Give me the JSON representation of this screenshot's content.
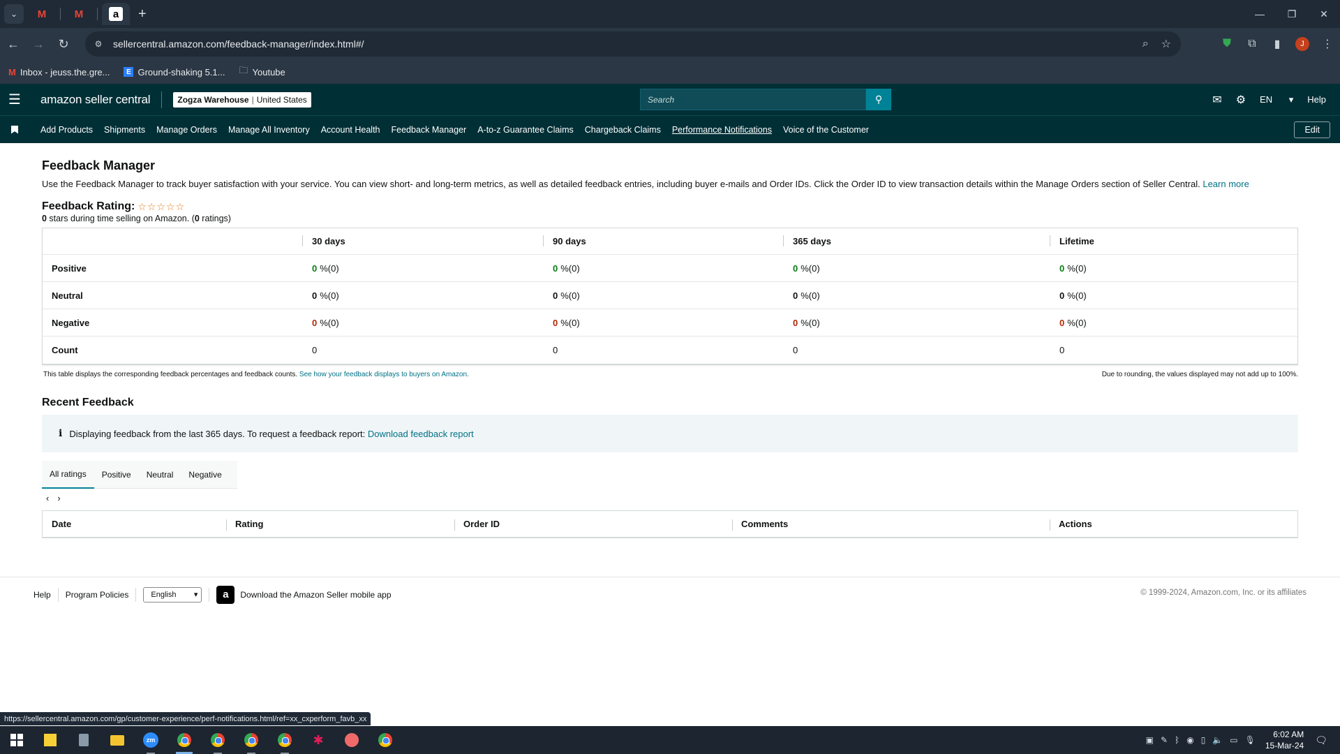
{
  "browser": {
    "url": "sellercentral.amazon.com/feedback-manager/index.html#/",
    "bookmarks": [
      "Inbox - jeuss.the.gre...",
      "Ground-shaking 5.1...",
      "Youtube"
    ],
    "status_url": "https://sellercentral.amazon.com/gp/customer-experience/perf-notifications.html/ref=xx_cxperform_favb_xx"
  },
  "header": {
    "logo": "amazon seller central",
    "store_name": "Zogza Warehouse",
    "store_region": "United States",
    "search_placeholder": "Search",
    "language": "EN",
    "help": "Help"
  },
  "nav": {
    "items": [
      "Add Products",
      "Shipments",
      "Manage Orders",
      "Manage All Inventory",
      "Account Health",
      "Feedback Manager",
      "A-to-z Guarantee Claims",
      "Chargeback Claims",
      "Performance Notifications",
      "Voice of the Customer"
    ],
    "edit": "Edit"
  },
  "page": {
    "title": "Feedback Manager",
    "intro": "Use the Feedback Manager to track buyer satisfaction with your service. You can view short- and long-term metrics, as well as detailed feedback entries, including buyer e-mails and Order IDs. Click the Order ID to view transaction details within the Manage Orders section of Seller Central.",
    "learn_more": "Learn more",
    "rating_title": "Feedback Rating:",
    "stars": "☆☆☆☆☆",
    "rating_stars_value": "0",
    "rating_sub_mid": " stars during time selling on Amazon. (",
    "rating_count": "0",
    "rating_sub_end": " ratings)"
  },
  "feedback_table": {
    "columns": [
      "30 days",
      "90 days",
      "365 days",
      "Lifetime"
    ],
    "rows": [
      {
        "label": "Positive",
        "cells": [
          {
            "value": "0",
            "rest": " %(0)"
          },
          {
            "value": "0",
            "rest": " %(0)"
          },
          {
            "value": "0",
            "rest": " %(0)"
          },
          {
            "value": "0",
            "rest": " %(0)"
          }
        ]
      },
      {
        "label": "Neutral",
        "cells": [
          {
            "value": "0",
            "rest": " %(0)"
          },
          {
            "value": "0",
            "rest": " %(0)"
          },
          {
            "value": "0",
            "rest": " %(0)"
          },
          {
            "value": "0",
            "rest": " %(0)"
          }
        ]
      },
      {
        "label": "Negative",
        "cells": [
          {
            "value": "0",
            "rest": " %(0)"
          },
          {
            "value": "0",
            "rest": " %(0)"
          },
          {
            "value": "0",
            "rest": " %(0)"
          },
          {
            "value": "0",
            "rest": " %(0)"
          }
        ]
      },
      {
        "label": "Count",
        "cells": [
          "0",
          "0",
          "0",
          "0"
        ]
      }
    ],
    "note_left": "This table displays the corresponding feedback percentages and feedback counts.",
    "note_link": "See how your feedback displays to buyers on Amazon.",
    "note_right": "Due to rounding, the values displayed may not add up to 100%."
  },
  "recent": {
    "title": "Recent Feedback",
    "info_text": "Displaying feedback from the last 365 days. To request a feedback report:",
    "info_link": "Download feedback report",
    "tabs": [
      "All ratings",
      "Positive",
      "Neutral",
      "Negative"
    ],
    "columns": [
      "Date",
      "Rating",
      "Order ID",
      "Comments",
      "Actions"
    ]
  },
  "footer": {
    "help": "Help",
    "policies": "Program Policies",
    "language": "English",
    "app": "Download the Amazon Seller mobile app",
    "copyright": "© 1999-2024, Amazon.com, Inc. or its affiliates"
  },
  "taskbar": {
    "time": "6:02 AM",
    "date": "15-Mar-24"
  },
  "colors": {
    "header_bg": "#002f36",
    "positive": "#067d12",
    "negative": "#b12704",
    "link": "#007185"
  }
}
